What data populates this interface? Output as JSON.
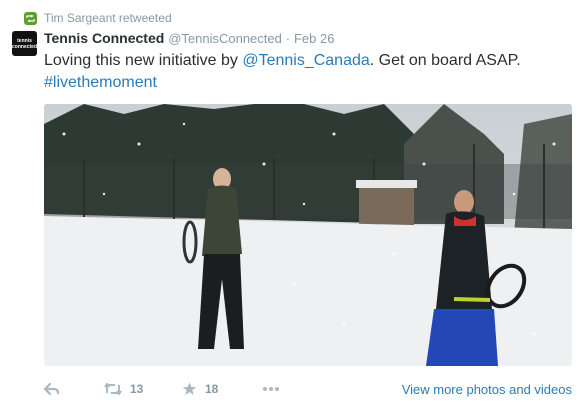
{
  "retweet": {
    "text": "Tim Sargeant retweeted",
    "icon": "retweet-icon"
  },
  "tweet": {
    "avatar_text": "tennis connected",
    "fullname": "Tennis Connected",
    "handle": "@TennisConnected",
    "separator": "·",
    "time": "Feb 26",
    "text_part1": "Loving this new initiative by ",
    "mention": "@Tennis_Canada",
    "text_part2": ". Get on board ASAP.",
    "hashtag": "#livethemoment"
  },
  "actions": {
    "reply_icon": "reply-icon",
    "retweet_icon": "retweet-icon",
    "retweet_count": "13",
    "favorite_icon": "star-icon",
    "favorite_count": "18",
    "more_icon": "more-dots-icon",
    "view_more": "View more photos and videos"
  },
  "colors": {
    "link": "#2b7bb9",
    "muted": "#8899a6",
    "retweet_green": "#5c9e31",
    "text": "#292f33"
  }
}
